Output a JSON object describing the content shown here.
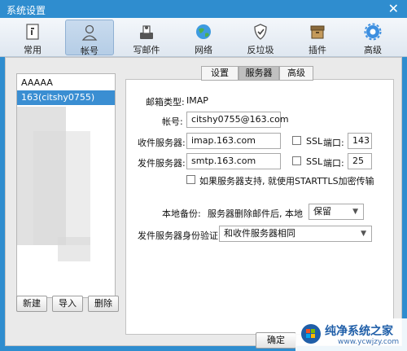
{
  "window": {
    "title": "系统设置",
    "close": "✕"
  },
  "toolbar": {
    "items": [
      {
        "label": "常用",
        "icon": "document-icon"
      },
      {
        "label": "帐号",
        "icon": "user-icon"
      },
      {
        "label": "写邮件",
        "icon": "compose-icon"
      },
      {
        "label": "网络",
        "icon": "globe-icon"
      },
      {
        "label": "反垃圾",
        "icon": "shield-icon"
      },
      {
        "label": "插件",
        "icon": "plugin-icon"
      },
      {
        "label": "高级",
        "icon": "gear-icon"
      }
    ],
    "active_index": 1
  },
  "accounts": {
    "items": [
      "AAAAA",
      "163(citshy0755)"
    ],
    "selected_index": 1
  },
  "account_buttons": {
    "new": "新建",
    "import": "导入",
    "delete": "删除"
  },
  "tabs": {
    "items": [
      "设置",
      "服务器",
      "高级"
    ],
    "active_index": 1
  },
  "server": {
    "mailbox_type_label": "邮箱类型:",
    "mailbox_type_value": "IMAP",
    "account_label": "帐号:",
    "account_value": "citshy0755@163.com",
    "incoming_label": "收件服务器:",
    "incoming_value": "imap.163.com",
    "incoming_ssl_label": "SSL",
    "incoming_port_label": "端口:",
    "incoming_port_value": "143",
    "outgoing_label": "发件服务器:",
    "outgoing_value": "smtp.163.com",
    "outgoing_ssl_label": "SSL",
    "outgoing_port_label": "端口:",
    "outgoing_port_value": "25",
    "starttls_label": "如果服务器支持, 就使用STARTTLS加密传输",
    "backup_label": "本地备份:",
    "backup_desc": "服务器删除邮件后, 本地",
    "backup_value": "保留",
    "auth_label": "发件服务器身份验证:",
    "auth_value": "和收件服务器相同"
  },
  "footer": {
    "ok": "确定"
  },
  "watermark": {
    "text": "纯净系统之家",
    "url": "www.ycwjzy.com"
  },
  "colors": {
    "titlebar": "#2f8dcf",
    "selection": "#3a8ed2",
    "watermark": "#1f5ea8"
  }
}
